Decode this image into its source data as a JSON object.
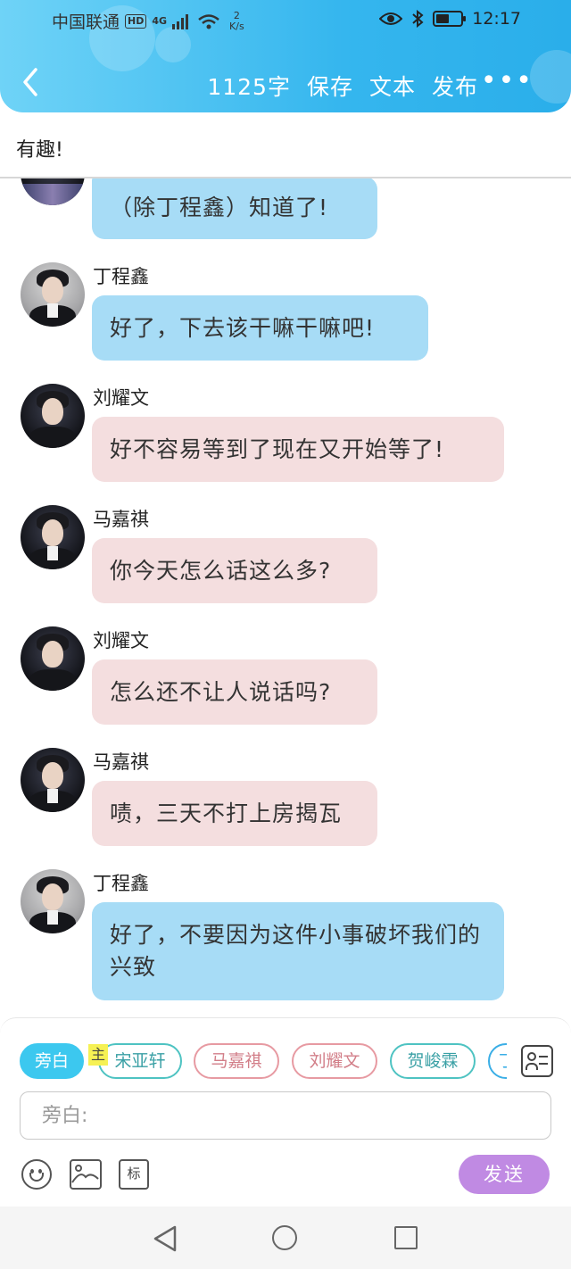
{
  "status_bar": {
    "carrier": "中国联通",
    "hd": "HD",
    "network": "4G",
    "speed_value": "2",
    "speed_unit": "K/s",
    "battery_level": 0.55,
    "time": "12:17"
  },
  "toolbar": {
    "word_count": "1125字",
    "save_label": "保存",
    "text_label": "文本",
    "publish_label": "发布",
    "more_label": "•••"
  },
  "title": "有趣!",
  "messages": [
    {
      "speaker": "",
      "text": "（除丁程鑫）知道了!",
      "color": "blue"
    },
    {
      "speaker": "丁程鑫",
      "text": "好了，下去该干嘛干嘛吧!",
      "color": "blue"
    },
    {
      "speaker": "刘耀文",
      "text": "好不容易等到了现在又开始等了!",
      "color": "pink"
    },
    {
      "speaker": "马嘉祺",
      "text": "你今天怎么话这么多?",
      "color": "pink"
    },
    {
      "speaker": "刘耀文",
      "text": "怎么还不让人说话吗?",
      "color": "pink"
    },
    {
      "speaker": "马嘉祺",
      "text": "啧，三天不打上房揭瓦",
      "color": "pink"
    },
    {
      "speaker": "丁程鑫",
      "text": "好了，不要因为这件小事破坏我们的兴致",
      "color": "blue"
    }
  ],
  "composer": {
    "chips": [
      "旁白",
      "宋亚轩",
      "马嘉祺",
      "刘耀文",
      "贺峻霖",
      "丁"
    ],
    "main_tag": "主",
    "input_placeholder": "旁白:",
    "tag_tool_label": "标",
    "send_label": "发送"
  },
  "colors": {
    "header_gradient_start": "#6fd3f7",
    "header_gradient_end": "#2aaeea",
    "bubble_blue": "#a7dcf6",
    "bubble_pink": "#f4dedf",
    "send_button": "#c08ae3",
    "chip_active": "#3cc8ef"
  }
}
